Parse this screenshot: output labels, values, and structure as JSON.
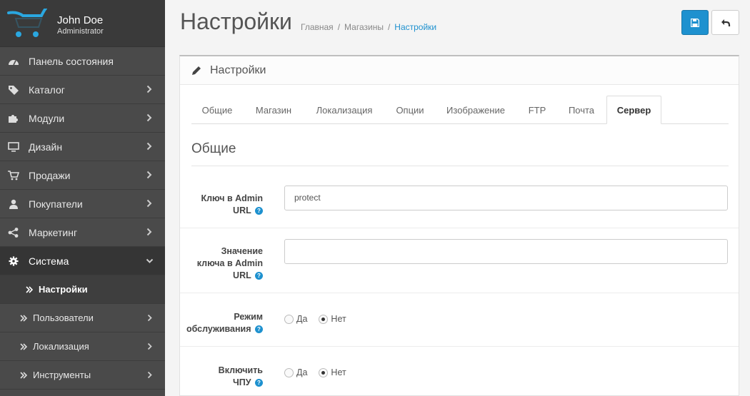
{
  "profile": {
    "name": "John Doe",
    "role": "Administrator"
  },
  "nav": {
    "dashboard": "Панель состояния",
    "catalog": "Каталог",
    "extensions": "Модули",
    "design": "Дизайн",
    "sales": "Продажи",
    "customers": "Покупатели",
    "marketing": "Маркетинг",
    "system": "Система",
    "sub": {
      "settings": "Настройки",
      "users": "Пользователи",
      "localisation": "Локализация",
      "tools": "Инструменты"
    }
  },
  "header": {
    "title": "Настройки",
    "breadcrumb": [
      "Главная",
      "Магазины",
      "Настройки"
    ],
    "separator": "/"
  },
  "panel": {
    "title": "Настройки",
    "tabs": [
      "Общие",
      "Магазин",
      "Локализация",
      "Опции",
      "Изображение",
      "FTP",
      "Почта",
      "Сервер"
    ],
    "active_tab": "Сервер",
    "legend": "Общие",
    "fields": {
      "admin_key": {
        "label": "Ключ в Admin URL",
        "label_line1": "Ключ в Admin",
        "label_line2": "URL",
        "value": "protect"
      },
      "admin_value": {
        "label_line1": "Значение",
        "label_line2": "ключа в Admin",
        "label_line3": "URL",
        "value": ""
      },
      "maintenance": {
        "label_line1": "Режим",
        "label_line2": "обслуживания",
        "yes": "Да",
        "no": "Нет",
        "selected": "Нет"
      },
      "seo": {
        "label_line1": "Включить",
        "label_line2": "ЧПУ",
        "yes": "Да",
        "no": "Нет",
        "selected": "Нет"
      }
    },
    "help_glyph": "?"
  },
  "colors": {
    "sidebar": "#4a4a4a",
    "accent": "#1e91cf"
  }
}
